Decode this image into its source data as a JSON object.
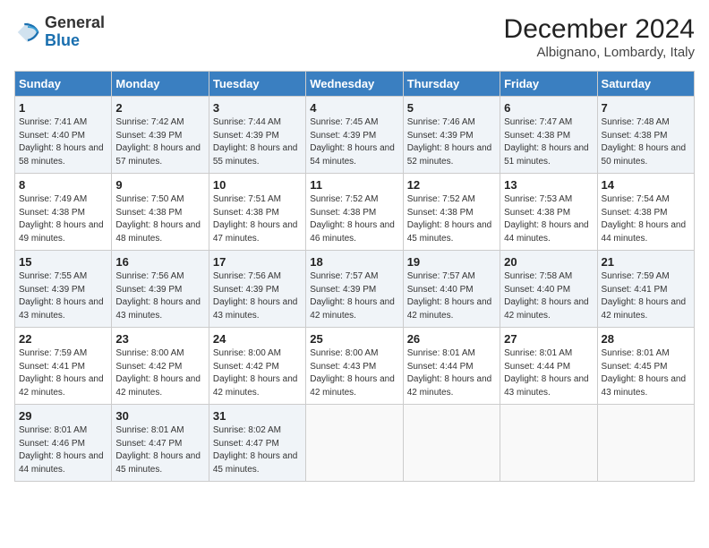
{
  "logo": {
    "general": "General",
    "blue": "Blue"
  },
  "title": "December 2024",
  "location": "Albignano, Lombardy, Italy",
  "days_of_week": [
    "Sunday",
    "Monday",
    "Tuesday",
    "Wednesday",
    "Thursday",
    "Friday",
    "Saturday"
  ],
  "weeks": [
    [
      {
        "day": "1",
        "sunrise": "Sunrise: 7:41 AM",
        "sunset": "Sunset: 4:40 PM",
        "daylight": "Daylight: 8 hours and 58 minutes."
      },
      {
        "day": "2",
        "sunrise": "Sunrise: 7:42 AM",
        "sunset": "Sunset: 4:39 PM",
        "daylight": "Daylight: 8 hours and 57 minutes."
      },
      {
        "day": "3",
        "sunrise": "Sunrise: 7:44 AM",
        "sunset": "Sunset: 4:39 PM",
        "daylight": "Daylight: 8 hours and 55 minutes."
      },
      {
        "day": "4",
        "sunrise": "Sunrise: 7:45 AM",
        "sunset": "Sunset: 4:39 PM",
        "daylight": "Daylight: 8 hours and 54 minutes."
      },
      {
        "day": "5",
        "sunrise": "Sunrise: 7:46 AM",
        "sunset": "Sunset: 4:39 PM",
        "daylight": "Daylight: 8 hours and 52 minutes."
      },
      {
        "day": "6",
        "sunrise": "Sunrise: 7:47 AM",
        "sunset": "Sunset: 4:38 PM",
        "daylight": "Daylight: 8 hours and 51 minutes."
      },
      {
        "day": "7",
        "sunrise": "Sunrise: 7:48 AM",
        "sunset": "Sunset: 4:38 PM",
        "daylight": "Daylight: 8 hours and 50 minutes."
      }
    ],
    [
      {
        "day": "8",
        "sunrise": "Sunrise: 7:49 AM",
        "sunset": "Sunset: 4:38 PM",
        "daylight": "Daylight: 8 hours and 49 minutes."
      },
      {
        "day": "9",
        "sunrise": "Sunrise: 7:50 AM",
        "sunset": "Sunset: 4:38 PM",
        "daylight": "Daylight: 8 hours and 48 minutes."
      },
      {
        "day": "10",
        "sunrise": "Sunrise: 7:51 AM",
        "sunset": "Sunset: 4:38 PM",
        "daylight": "Daylight: 8 hours and 47 minutes."
      },
      {
        "day": "11",
        "sunrise": "Sunrise: 7:52 AM",
        "sunset": "Sunset: 4:38 PM",
        "daylight": "Daylight: 8 hours and 46 minutes."
      },
      {
        "day": "12",
        "sunrise": "Sunrise: 7:52 AM",
        "sunset": "Sunset: 4:38 PM",
        "daylight": "Daylight: 8 hours and 45 minutes."
      },
      {
        "day": "13",
        "sunrise": "Sunrise: 7:53 AM",
        "sunset": "Sunset: 4:38 PM",
        "daylight": "Daylight: 8 hours and 44 minutes."
      },
      {
        "day": "14",
        "sunrise": "Sunrise: 7:54 AM",
        "sunset": "Sunset: 4:38 PM",
        "daylight": "Daylight: 8 hours and 44 minutes."
      }
    ],
    [
      {
        "day": "15",
        "sunrise": "Sunrise: 7:55 AM",
        "sunset": "Sunset: 4:39 PM",
        "daylight": "Daylight: 8 hours and 43 minutes."
      },
      {
        "day": "16",
        "sunrise": "Sunrise: 7:56 AM",
        "sunset": "Sunset: 4:39 PM",
        "daylight": "Daylight: 8 hours and 43 minutes."
      },
      {
        "day": "17",
        "sunrise": "Sunrise: 7:56 AM",
        "sunset": "Sunset: 4:39 PM",
        "daylight": "Daylight: 8 hours and 43 minutes."
      },
      {
        "day": "18",
        "sunrise": "Sunrise: 7:57 AM",
        "sunset": "Sunset: 4:39 PM",
        "daylight": "Daylight: 8 hours and 42 minutes."
      },
      {
        "day": "19",
        "sunrise": "Sunrise: 7:57 AM",
        "sunset": "Sunset: 4:40 PM",
        "daylight": "Daylight: 8 hours and 42 minutes."
      },
      {
        "day": "20",
        "sunrise": "Sunrise: 7:58 AM",
        "sunset": "Sunset: 4:40 PM",
        "daylight": "Daylight: 8 hours and 42 minutes."
      },
      {
        "day": "21",
        "sunrise": "Sunrise: 7:59 AM",
        "sunset": "Sunset: 4:41 PM",
        "daylight": "Daylight: 8 hours and 42 minutes."
      }
    ],
    [
      {
        "day": "22",
        "sunrise": "Sunrise: 7:59 AM",
        "sunset": "Sunset: 4:41 PM",
        "daylight": "Daylight: 8 hours and 42 minutes."
      },
      {
        "day": "23",
        "sunrise": "Sunrise: 8:00 AM",
        "sunset": "Sunset: 4:42 PM",
        "daylight": "Daylight: 8 hours and 42 minutes."
      },
      {
        "day": "24",
        "sunrise": "Sunrise: 8:00 AM",
        "sunset": "Sunset: 4:42 PM",
        "daylight": "Daylight: 8 hours and 42 minutes."
      },
      {
        "day": "25",
        "sunrise": "Sunrise: 8:00 AM",
        "sunset": "Sunset: 4:43 PM",
        "daylight": "Daylight: 8 hours and 42 minutes."
      },
      {
        "day": "26",
        "sunrise": "Sunrise: 8:01 AM",
        "sunset": "Sunset: 4:44 PM",
        "daylight": "Daylight: 8 hours and 42 minutes."
      },
      {
        "day": "27",
        "sunrise": "Sunrise: 8:01 AM",
        "sunset": "Sunset: 4:44 PM",
        "daylight": "Daylight: 8 hours and 43 minutes."
      },
      {
        "day": "28",
        "sunrise": "Sunrise: 8:01 AM",
        "sunset": "Sunset: 4:45 PM",
        "daylight": "Daylight: 8 hours and 43 minutes."
      }
    ],
    [
      {
        "day": "29",
        "sunrise": "Sunrise: 8:01 AM",
        "sunset": "Sunset: 4:46 PM",
        "daylight": "Daylight: 8 hours and 44 minutes."
      },
      {
        "day": "30",
        "sunrise": "Sunrise: 8:01 AM",
        "sunset": "Sunset: 4:47 PM",
        "daylight": "Daylight: 8 hours and 45 minutes."
      },
      {
        "day": "31",
        "sunrise": "Sunrise: 8:02 AM",
        "sunset": "Sunset: 4:47 PM",
        "daylight": "Daylight: 8 hours and 45 minutes."
      },
      null,
      null,
      null,
      null
    ]
  ]
}
